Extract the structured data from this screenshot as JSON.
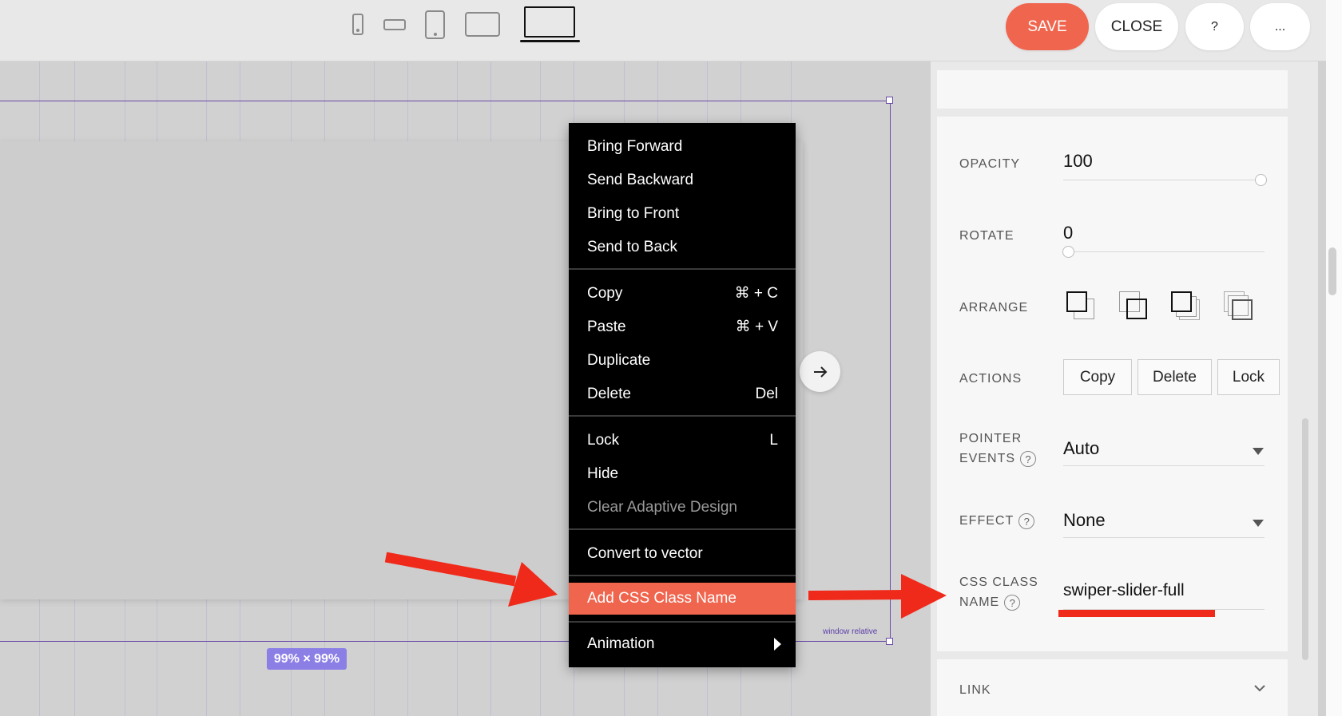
{
  "toolbar": {
    "devices": [
      "phone-icon",
      "phone-landscape-icon",
      "tablet-icon",
      "tablet-landscape-icon",
      "laptop-icon"
    ],
    "save_label": "SAVE",
    "close_label": "CLOSE",
    "help_label": "?",
    "more_label": "...",
    "accent_color": "#f0654e"
  },
  "canvas": {
    "size_badge": "99% × 99%",
    "window_relative": "window relative"
  },
  "context_menu": {
    "items": [
      {
        "label": "Bring Forward",
        "shortcut": ""
      },
      {
        "label": "Send Backward",
        "shortcut": ""
      },
      {
        "label": "Bring to Front",
        "shortcut": ""
      },
      {
        "label": "Send to Back",
        "shortcut": ""
      },
      {
        "label": "Copy",
        "shortcut": "⌘ + C"
      },
      {
        "label": "Paste",
        "shortcut": "⌘ + V"
      },
      {
        "label": "Duplicate",
        "shortcut": ""
      },
      {
        "label": "Delete",
        "shortcut": "Del"
      },
      {
        "label": "Lock",
        "shortcut": "L"
      },
      {
        "label": "Hide",
        "shortcut": ""
      },
      {
        "label": "Clear Adaptive Design",
        "shortcut": "",
        "disabled": true
      },
      {
        "label": "Convert to vector",
        "shortcut": ""
      },
      {
        "label": "Add CSS Class Name",
        "shortcut": "",
        "highlighted": true
      },
      {
        "label": "Animation",
        "shortcut": "",
        "submenu": true
      }
    ]
  },
  "panel": {
    "opacity": {
      "label": "OPACITY",
      "value": "100"
    },
    "rotate": {
      "label": "ROTATE",
      "value": "0"
    },
    "arrange": {
      "label": "ARRANGE"
    },
    "actions": {
      "label": "ACTIONS",
      "copy": "Copy",
      "delete": "Delete",
      "lock": "Lock"
    },
    "pointer_events": {
      "label_1": "POINTER",
      "label_2": "EVENTS",
      "value": "Auto"
    },
    "effect": {
      "label": "EFFECT",
      "value": "None"
    },
    "css_class": {
      "label_1": "CSS CLASS",
      "label_2": "NAME",
      "value": "swiper-slider-full"
    },
    "link": {
      "label": "LINK"
    },
    "help_glyph": "?"
  }
}
